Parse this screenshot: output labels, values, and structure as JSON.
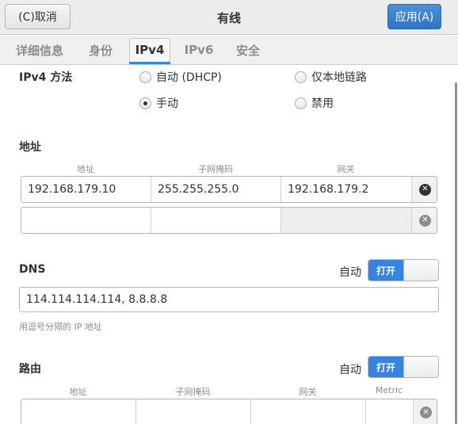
{
  "header": {
    "cancel_label": "(C)取消",
    "title": "有线",
    "apply_label": "应用(A)"
  },
  "tabs": [
    {
      "label": "详细信息",
      "active": false
    },
    {
      "label": "身份",
      "active": false
    },
    {
      "label": "IPv4",
      "active": true
    },
    {
      "label": "IPv6",
      "active": false
    },
    {
      "label": "安全",
      "active": false
    }
  ],
  "ipv4": {
    "method_label": "IPv4 方法",
    "methods": [
      {
        "label": "自动 (DHCP)",
        "checked": false
      },
      {
        "label": "仅本地链路",
        "checked": false
      },
      {
        "label": "手动",
        "checked": true
      },
      {
        "label": "禁用",
        "checked": false
      }
    ]
  },
  "addresses": {
    "section_label": "地址",
    "col_address": "地址",
    "col_netmask": "子网掩码",
    "col_gateway": "网关",
    "rows": [
      {
        "address": "192.168.179.10",
        "netmask": "255.255.255.0",
        "gateway": "192.168.179.2"
      },
      {
        "address": "",
        "netmask": "",
        "gateway": ""
      }
    ]
  },
  "dns": {
    "section_label": "DNS",
    "auto_label": "自动",
    "switch_label": "打开",
    "switch_on": true,
    "value": "114.114.114.114, 8.8.8.8",
    "hint": "用逗号分隔的 IP 地址"
  },
  "routes": {
    "section_label": "路由",
    "auto_label": "自动",
    "switch_label": "打开",
    "switch_on": true,
    "col_address": "地址",
    "col_netmask": "子网掩码",
    "col_gateway": "网关",
    "col_metric": "Metric"
  },
  "icons": {
    "delete": "clear-circle-icon"
  },
  "colors": {
    "accent": "#3584e4",
    "apply_button": "#2f74c4"
  }
}
